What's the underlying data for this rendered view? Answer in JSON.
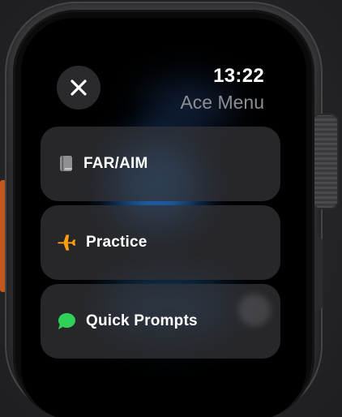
{
  "header": {
    "time": "13:22",
    "title": "Ace Menu",
    "close_icon": "xmark-icon"
  },
  "menu": {
    "items": [
      {
        "label": "FAR/AIM",
        "icon": "book-icon",
        "icon_color": "#8e8e93"
      },
      {
        "label": "Practice",
        "icon": "airplane-icon",
        "icon_color": "#ff9f0a"
      },
      {
        "label": "Quick Prompts",
        "icon": "message-bubble-icon",
        "icon_color": "#30d158"
      }
    ]
  },
  "colors": {
    "accent_orange": "#c2581c",
    "glow_blue": "#2878d2",
    "cell_background": "#323236"
  }
}
